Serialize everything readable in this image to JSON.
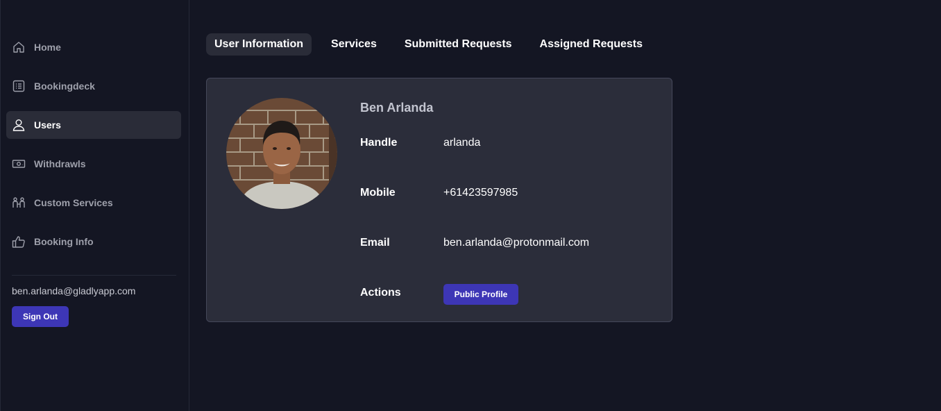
{
  "sidebar": {
    "items": [
      {
        "label": "Home",
        "icon": "home-icon"
      },
      {
        "label": "Bookingdeck",
        "icon": "list-icon"
      },
      {
        "label": "Users",
        "icon": "user-icon",
        "active": true
      },
      {
        "label": "Withdrawls",
        "icon": "banknote-icon"
      },
      {
        "label": "Custom Services",
        "icon": "people-icon"
      },
      {
        "label": "Booking Info",
        "icon": "thumbs-up-icon"
      }
    ],
    "user_email": "ben.arlanda@gladlyapp.com",
    "signout_label": "Sign Out"
  },
  "tabs": [
    {
      "label": "User Information",
      "active": true
    },
    {
      "label": "Services"
    },
    {
      "label": "Submitted Requests"
    },
    {
      "label": "Assigned Requests"
    }
  ],
  "profile": {
    "name": "Ben Arlanda",
    "handle_label": "Handle",
    "handle": "arlanda",
    "mobile_label": "Mobile",
    "mobile": "+61423597985",
    "email_label": "Email",
    "email": "ben.arlanda@protonmail.com",
    "actions_label": "Actions",
    "public_profile_label": "Public Profile"
  },
  "colors": {
    "background": "#141623",
    "card": "#2b2d3a",
    "accent": "#3d36b6",
    "active_item": "#2a2c38"
  }
}
